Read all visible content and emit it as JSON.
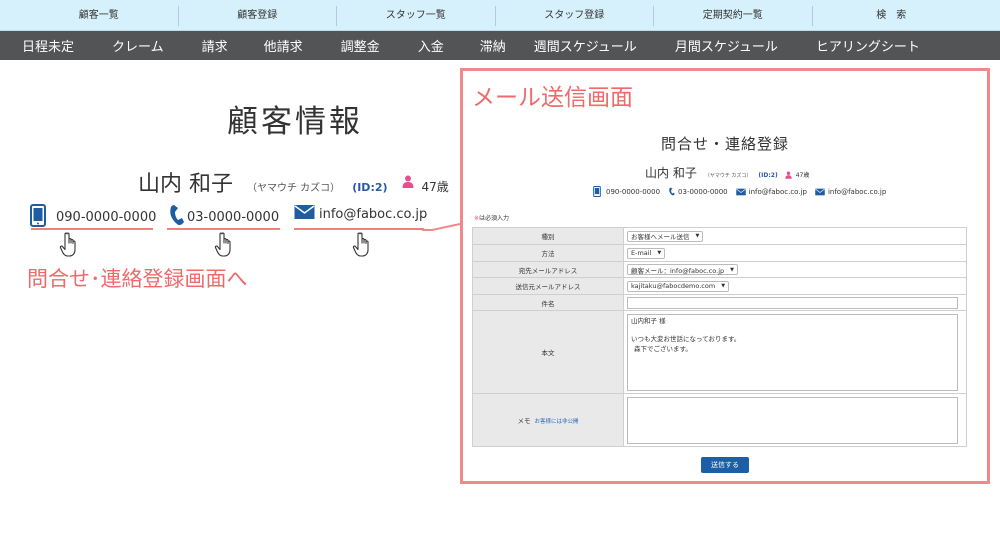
{
  "top_nav": [
    "顧客一覧",
    "顧客登録",
    "スタッフ一覧",
    "スタッフ登録",
    "定期契約一覧",
    "検　索"
  ],
  "main_nav": [
    "日程未定",
    "クレーム",
    "請求",
    "他請求",
    "調整金",
    "入金",
    "滞納",
    "週間スケジュール",
    "月間スケジュール",
    "ヒアリングシート"
  ],
  "customer": {
    "section_title": "顧客情報",
    "name": "山内 和子",
    "kana": "（ヤマウチ カズコ）",
    "id_label": "(ID:2)",
    "age": "47歳",
    "mobile": "090-0000-0000",
    "phone": "03-0000-0000",
    "email": "info@faboc.co.jp"
  },
  "annotations": {
    "left_label": "問合せ･連絡登録画面へ",
    "right_label": "メール送信画面"
  },
  "form": {
    "title": "問合せ・連絡登録",
    "name": "山内 和子",
    "kana": "（ヤマウチ カズコ）",
    "id_label": "(ID:2)",
    "age": "47歳",
    "contacts": [
      "090-0000-0000",
      "03-0000-0000",
      "info@faboc.co.jp",
      "info@faboc.co.jp"
    ],
    "required_note_mark": "※",
    "required_note": "は必須入力",
    "rows": {
      "kind_label": "種別",
      "kind_value": "お客様へメール送信",
      "method_label": "方法",
      "method_value": "E-mail",
      "to_label": "宛先メールアドレス",
      "to_value": "顧客メール：info@faboc.co.jp",
      "from_label": "送信元メールアドレス",
      "from_value": "kajitaku@fabocdemo.com",
      "subject_label": "件名",
      "subject_value": "",
      "body_label": "本文",
      "body_line1": "山内和子 様",
      "body_line2": "いつも大変お世話になっております。",
      "body_line3": "森下でございます。",
      "memo_label": "メモ",
      "memo_note": "お客様には非公開"
    },
    "submit": "送信する"
  },
  "colors": {
    "top_nav_bg": "#d6f1fb",
    "dark_nav_bg": "#525456",
    "accent_red": "#ef6a6a",
    "link_blue": "#2a5aa3",
    "button_blue": "#1c5fa6"
  }
}
